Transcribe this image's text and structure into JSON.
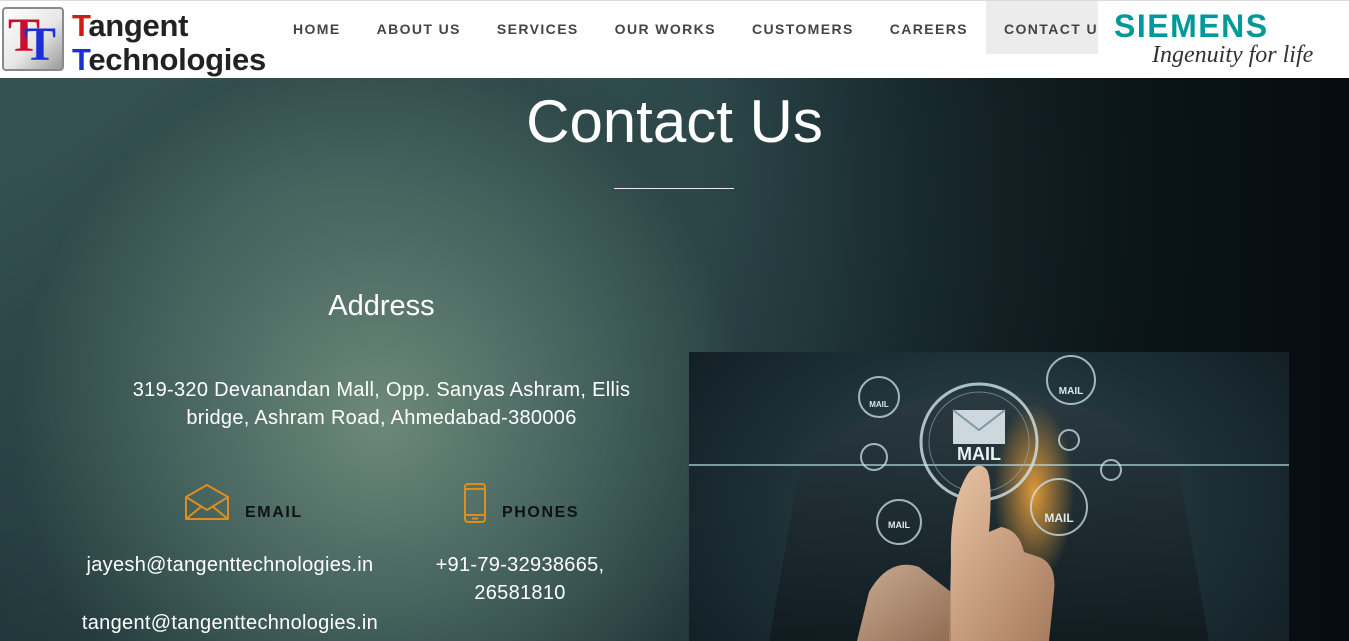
{
  "brand": {
    "logo_line1": "Tangent",
    "logo_line2": "Technologies",
    "logo_mark": "TT",
    "colors": {
      "red": "#d11a1a",
      "blue": "#1a2fd6"
    }
  },
  "nav": {
    "items": [
      {
        "label": "HOME",
        "active": false
      },
      {
        "label": "ABOUT US",
        "active": false
      },
      {
        "label": "SERVICES",
        "active": false
      },
      {
        "label": "OUR WORKS",
        "active": false
      },
      {
        "label": "CUSTOMERS",
        "active": false
      },
      {
        "label": "CAREERS",
        "active": false
      },
      {
        "label": "CONTACT US",
        "active": true
      }
    ]
  },
  "partner": {
    "name": "SIEMENS",
    "tagline": "Ingenuity for life",
    "color": "#009999"
  },
  "hero": {
    "title": "Contact Us"
  },
  "address": {
    "heading": "Address",
    "text": "319-320 Devanandan Mall, Opp. Sanyas Ashram, Ellis bridge, Ashram Road, Ahmedabad-380006"
  },
  "email": {
    "label": "EMAIL",
    "values": [
      "jayesh@tangenttechnologies.in",
      "tangent@tangenttechnologies.in"
    ],
    "icon": "envelope-icon"
  },
  "phones": {
    "label": "PHONES",
    "line1": "+91-79-32938665,",
    "line2": "26581810",
    "icon": "mobile-phone-icon"
  },
  "image": {
    "mail_label": "MAIL",
    "accent": "#d98a1f"
  }
}
